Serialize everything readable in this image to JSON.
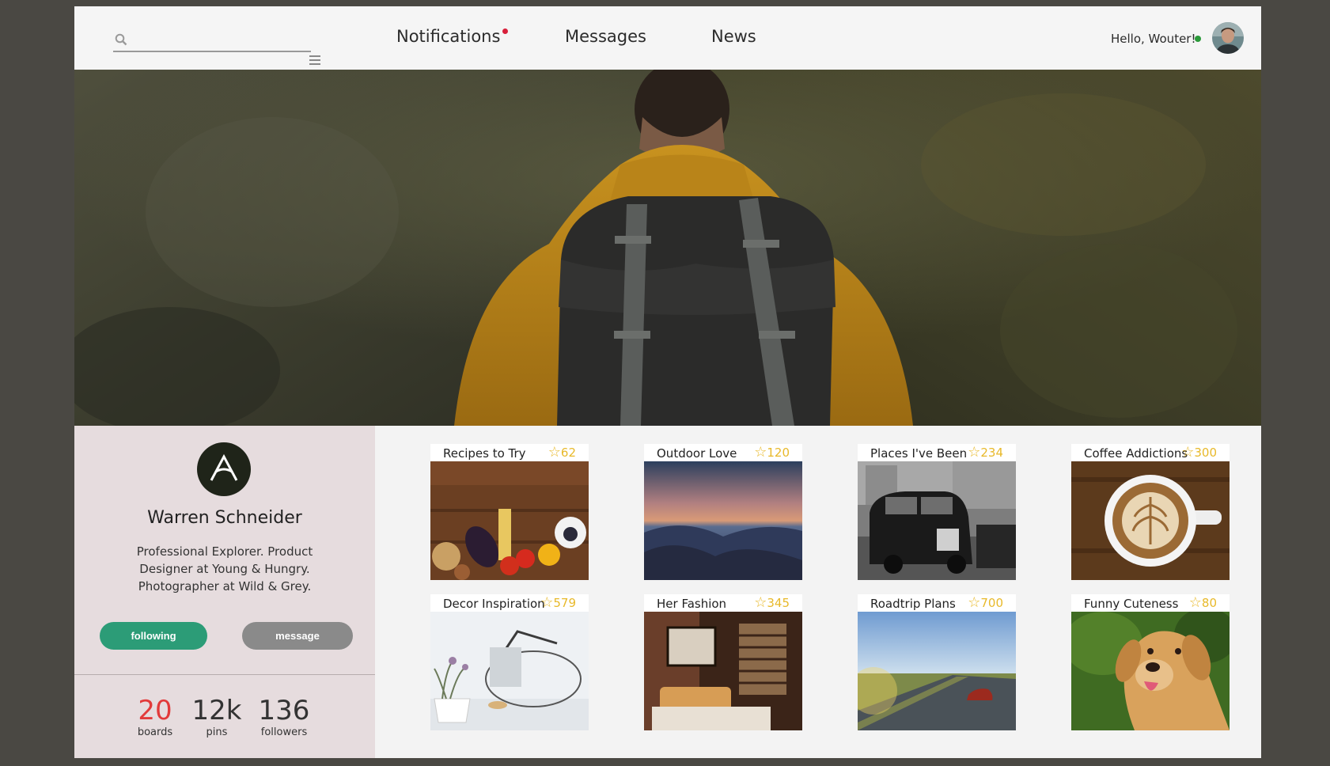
{
  "header": {
    "search": {
      "placeholder": "",
      "value": ""
    },
    "nav": [
      {
        "label": "Notifications",
        "has_alert": true
      },
      {
        "label": "Messages"
      },
      {
        "label": "News"
      }
    ],
    "greeting": "Hello, Wouter!",
    "status": "online"
  },
  "profile": {
    "name": "Warren Schneider",
    "bio_lines": [
      "Professional Explorer. Product",
      "Designer at Young & Hungry.",
      "Photographer at Wild & Grey."
    ],
    "following_label": "following",
    "message_label": "message",
    "stats": [
      {
        "value": "20",
        "label": "boards"
      },
      {
        "value": "12k",
        "label": "pins"
      },
      {
        "value": "136",
        "label": "followers"
      }
    ]
  },
  "boards": [
    {
      "title": "Recipes to Try",
      "stars": "62"
    },
    {
      "title": "Outdoor Love",
      "stars": "120"
    },
    {
      "title": "Places I've Been",
      "stars": "234"
    },
    {
      "title": "Coffee Addictions",
      "stars": "300"
    },
    {
      "title": "Decor Inspiration",
      "stars": "579"
    },
    {
      "title": "Her Fashion",
      "stars": "345"
    },
    {
      "title": "Roadtrip Plans",
      "stars": "700"
    },
    {
      "title": "Funny Cuteness",
      "stars": "80"
    }
  ],
  "colors": {
    "accent_green": "#2c9c77",
    "alert_red": "#d81f3a",
    "star_gold": "#e8b92a",
    "boards_count_red": "#e23a3a"
  }
}
